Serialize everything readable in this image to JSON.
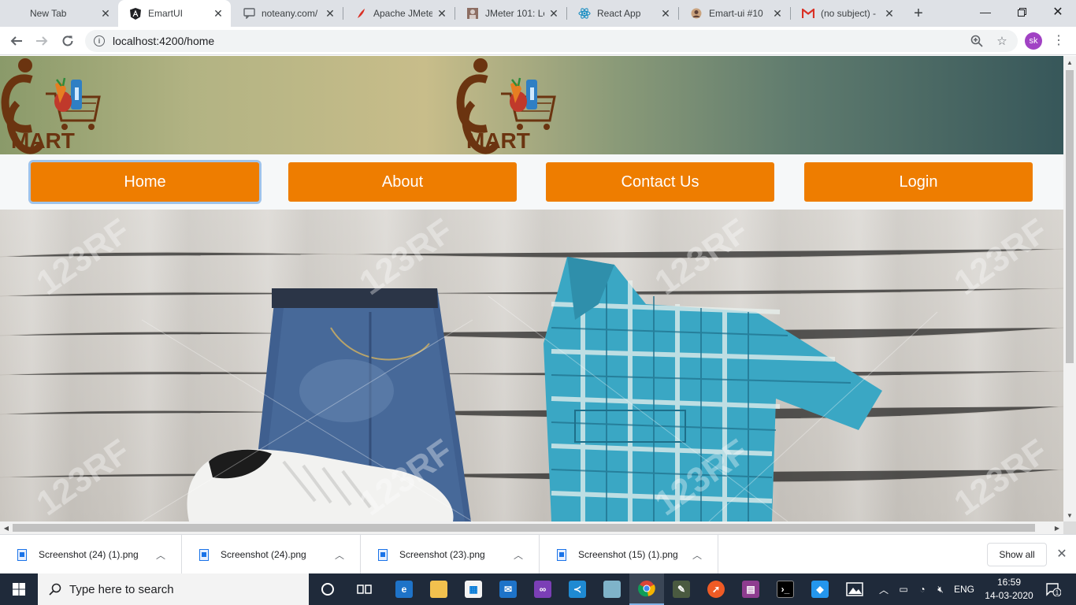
{
  "browser": {
    "tabs": [
      {
        "title": "New Tab",
        "icon": "blank-icon",
        "active": false
      },
      {
        "title": "EmartUI",
        "icon": "angular-icon",
        "active": true
      },
      {
        "title": "noteany.com/",
        "icon": "chat-icon",
        "active": false
      },
      {
        "title": "Apache JMeter",
        "icon": "feather-icon",
        "active": false
      },
      {
        "title": "JMeter 101: Lo",
        "icon": "portrait-icon",
        "active": false
      },
      {
        "title": "React App",
        "icon": "react-icon",
        "active": false
      },
      {
        "title": "Emart-ui #10",
        "icon": "github-icon",
        "active": false
      },
      {
        "title": "(no subject) -",
        "icon": "gmail-icon",
        "active": false
      }
    ],
    "new_tab_label": "+",
    "url": "localhost:4200/home",
    "profile_initials": "sk"
  },
  "page": {
    "nav": [
      {
        "label": "Home",
        "focused": true
      },
      {
        "label": "About",
        "focused": false
      },
      {
        "label": "Contact Us",
        "focused": false
      },
      {
        "label": "Login",
        "focused": false
      }
    ],
    "logo_text": "MART",
    "hero": {
      "watermark": "123RF",
      "description": "jeans, plaid shirt and sneakers on wooden floor"
    }
  },
  "downloads": {
    "items": [
      {
        "name": "Screenshot (24) (1).png"
      },
      {
        "name": "Screenshot (24).png"
      },
      {
        "name": "Screenshot (23).png"
      },
      {
        "name": "Screenshot (15) (1).png"
      }
    ],
    "show_all": "Show all"
  },
  "taskbar": {
    "search_placeholder": "Type here to search",
    "language": "ENG",
    "time": "16:59",
    "date": "14-03-2020",
    "notification_count": "1"
  },
  "colors": {
    "nav_button": "#ee7d00",
    "focus_ring": "#9fc3ea",
    "logo_brown": "#6b3410"
  }
}
